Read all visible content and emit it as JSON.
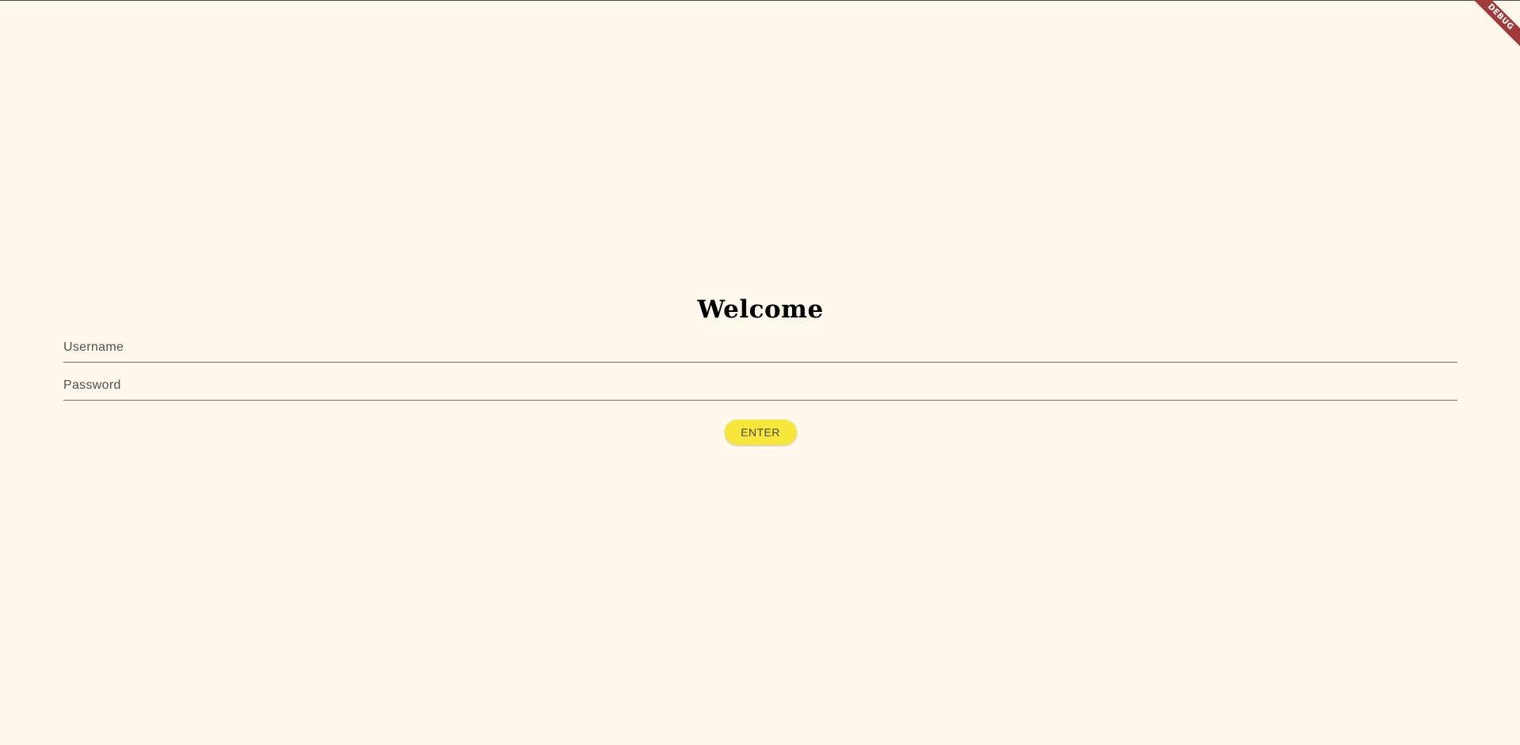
{
  "app": {
    "debug_banner": "DEBUG"
  },
  "login": {
    "title": "Welcome",
    "username_placeholder": "Username",
    "password_placeholder": "Password",
    "enter_label": "ENTER"
  },
  "colors": {
    "background": "#fff8eb",
    "button": "#f7e73a",
    "debug_ribbon": "#a13b3b"
  }
}
